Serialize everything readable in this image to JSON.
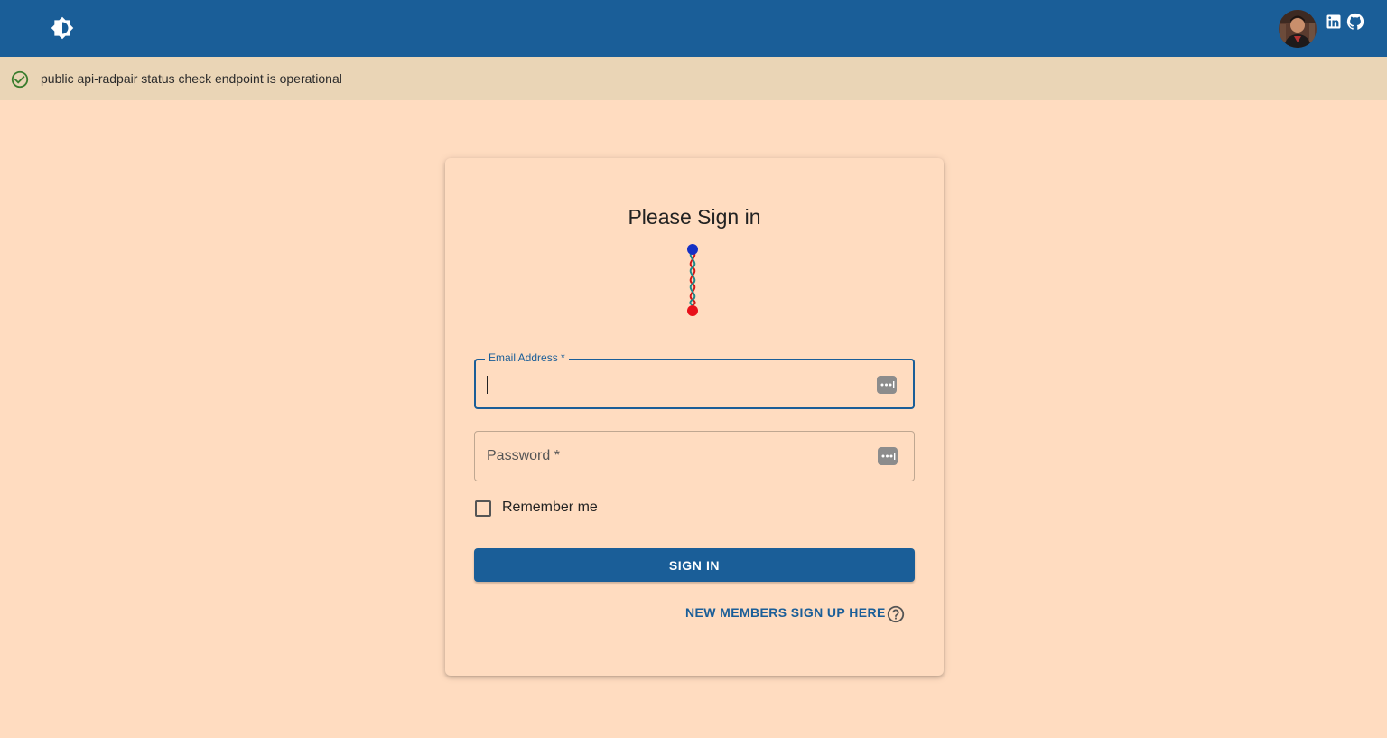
{
  "header": {
    "theme_toggle_icon": "brightness-toggle-icon",
    "avatar_icon": "user-avatar",
    "social_icons": [
      "linkedin-icon",
      "github-icon"
    ],
    "color": "#1A5E98"
  },
  "status": {
    "icon": "check-circle-icon",
    "text": "public api-radpair status check endpoint is operational",
    "icon_color": "#3B7D2E"
  },
  "login": {
    "title": "Please Sign in",
    "logo_icon": "dna-helix-icon",
    "email_label": "Email Address *",
    "email_value": "",
    "password_label": "Password *",
    "password_value": "",
    "field_icon": "password-manager-icon",
    "remember_label": "Remember me",
    "remember_checked": false,
    "signin_label": "SIGN IN",
    "signup_label": "NEW MEMBERS SIGN UP HERE",
    "help_icon": "help-circle-icon"
  },
  "colors": {
    "background": "#FFDCC0",
    "status_bar": "#EAD5B6",
    "primary": "#1A5E98"
  }
}
